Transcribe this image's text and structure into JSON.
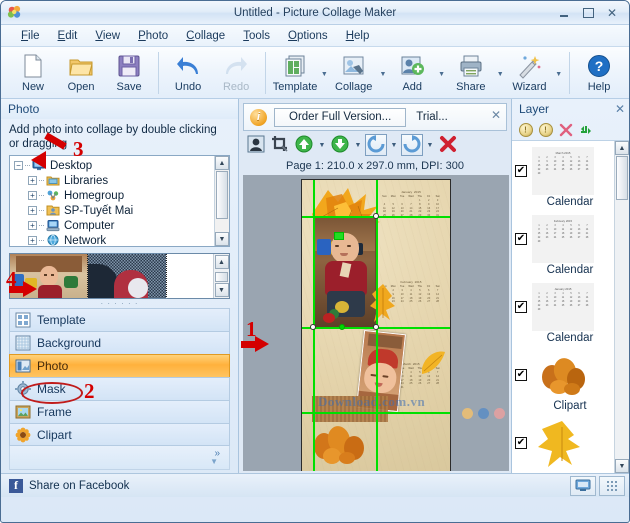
{
  "window": {
    "title": "Untitled - Picture Collage Maker",
    "app_icon": "flower-icon",
    "minimize": "–",
    "maximize": "□",
    "close": "✕"
  },
  "menubar": {
    "items": [
      {
        "label": "File",
        "accel": "F"
      },
      {
        "label": "Edit",
        "accel": "E"
      },
      {
        "label": "View",
        "accel": "V"
      },
      {
        "label": "Photo",
        "accel": "P"
      },
      {
        "label": "Collage",
        "accel": "C"
      },
      {
        "label": "Tools",
        "accel": "T"
      },
      {
        "label": "Options",
        "accel": "O"
      },
      {
        "label": "Help",
        "accel": "H"
      }
    ]
  },
  "toolbar": {
    "items": [
      {
        "label": "New",
        "icon": "new-document-icon",
        "dropdown": false,
        "disabled": false
      },
      {
        "label": "Open",
        "icon": "open-folder-icon",
        "dropdown": false,
        "disabled": false
      },
      {
        "label": "Save",
        "icon": "floppy-disk-icon",
        "dropdown": false,
        "disabled": false
      },
      {
        "label": "Undo",
        "icon": "undo-arrow-icon",
        "dropdown": false,
        "disabled": false
      },
      {
        "label": "Redo",
        "icon": "redo-arrow-icon",
        "dropdown": false,
        "disabled": true
      },
      {
        "label": "Template",
        "icon": "template-icon",
        "dropdown": true,
        "disabled": false
      },
      {
        "label": "Collage",
        "icon": "collage-icon",
        "dropdown": true,
        "disabled": false
      },
      {
        "label": "Add",
        "icon": "add-person-icon",
        "dropdown": true,
        "disabled": false
      },
      {
        "label": "Share",
        "icon": "printer-icon",
        "dropdown": true,
        "disabled": false
      },
      {
        "label": "Wizard",
        "icon": "magic-wand-icon",
        "dropdown": true,
        "disabled": false
      },
      {
        "label": "Help",
        "icon": "help-question-icon",
        "dropdown": false,
        "disabled": false
      }
    ]
  },
  "left_panel": {
    "title": "Photo",
    "hint": "Add photo into collage by double clicking or dragging",
    "tree": [
      {
        "label": "Desktop",
        "level": 0,
        "expander": "−",
        "icon": "monitor-icon"
      },
      {
        "label": "Libraries",
        "level": 1,
        "expander": "+",
        "icon": "library-folder-icon"
      },
      {
        "label": "Homegroup",
        "level": 1,
        "expander": "+",
        "icon": "homegroup-icon"
      },
      {
        "label": "SP-Tuyết Mai",
        "level": 1,
        "expander": "+",
        "icon": "user-folder-icon"
      },
      {
        "label": "Computer",
        "level": 1,
        "expander": "+",
        "icon": "computer-icon"
      },
      {
        "label": "Network",
        "level": 1,
        "expander": "+",
        "icon": "network-icon"
      }
    ],
    "thumbnails": [
      {
        "name": "baby-photo-thumbnail-1",
        "selected": false
      },
      {
        "name": "baby-photo-thumbnail-2",
        "selected": true
      }
    ],
    "categories": [
      {
        "label": "Template",
        "icon": "template-grid-icon",
        "active": false
      },
      {
        "label": "Background",
        "icon": "background-icon",
        "active": false
      },
      {
        "label": "Photo",
        "icon": "photo-icon",
        "active": true
      },
      {
        "label": "Mask",
        "icon": "mask-gear-icon",
        "active": false
      },
      {
        "label": "Frame",
        "icon": "frame-picture-icon",
        "active": false
      },
      {
        "label": "Clipart",
        "icon": "clipart-flower-icon",
        "active": false
      }
    ],
    "expand_more": "»"
  },
  "center_panel": {
    "order_bar": {
      "info_icon": "info-icon",
      "order_button": "Order Full Version...",
      "trial_label": "Trial...",
      "close": "✕"
    },
    "canvas_tools": [
      {
        "name": "portrait-tool",
        "icon": "portrait-icon",
        "dropdown": false,
        "framed": false
      },
      {
        "name": "crop-tool",
        "icon": "crop-icon",
        "dropdown": false,
        "framed": false
      },
      {
        "name": "move-up-tool",
        "icon": "green-up-arrow-icon",
        "dropdown": true,
        "framed": false
      },
      {
        "name": "move-down-tool",
        "icon": "green-down-arrow-icon",
        "dropdown": true,
        "framed": false
      },
      {
        "name": "rotate-left-tool",
        "icon": "rotate-ccw-icon",
        "dropdown": true,
        "framed": true
      },
      {
        "name": "rotate-right-tool",
        "icon": "rotate-cw-icon",
        "dropdown": true,
        "framed": true
      },
      {
        "name": "delete-tool",
        "icon": "red-x-icon",
        "dropdown": false,
        "framed": false
      }
    ],
    "page_label": "Page 1: 210.0 x 297.0 mm, DPI: 300",
    "watermark": "Download.com.vn",
    "calendars": [
      {
        "month": "January",
        "year": "2015",
        "weekdays": [
          "Sun",
          "Mon",
          "Tue",
          "Wed",
          "Thu",
          "Fri",
          "Sat"
        ],
        "rows": [
          [
            "",
            "",
            "",
            "",
            "1",
            "2",
            "3"
          ],
          [
            "4",
            "5",
            "6",
            "7",
            "8",
            "9",
            "10"
          ],
          [
            "11",
            "12",
            "13",
            "14",
            "15",
            "16",
            "17"
          ],
          [
            "18",
            "19",
            "20",
            "21",
            "22",
            "23",
            "24"
          ],
          [
            "25",
            "26",
            "27",
            "28",
            "29",
            "30",
            "31"
          ]
        ]
      },
      {
        "month": "February",
        "year": "2015",
        "weekdays": [
          "Sun",
          "Mon",
          "Tue",
          "Wed",
          "Thu",
          "Fri",
          "Sat"
        ],
        "rows": [
          [
            "1",
            "2",
            "3",
            "4",
            "5",
            "6",
            "7"
          ],
          [
            "8",
            "9",
            "10",
            "11",
            "12",
            "13",
            "14"
          ],
          [
            "15",
            "16",
            "17",
            "18",
            "19",
            "20",
            "21"
          ],
          [
            "22",
            "23",
            "24",
            "25",
            "26",
            "27",
            "28"
          ]
        ]
      },
      {
        "month": "March",
        "year": "2015",
        "weekdays": [
          "Sun",
          "Mon",
          "Tue",
          "Wed",
          "Thu",
          "Fri",
          "Sat"
        ],
        "rows": [
          [
            "1",
            "2",
            "3",
            "4",
            "5",
            "6",
            "7"
          ],
          [
            "8",
            "9",
            "10",
            "11",
            "12",
            "13",
            "14"
          ],
          [
            "15",
            "16",
            "17",
            "18",
            "19",
            "20",
            "21"
          ],
          [
            "22",
            "23",
            "24",
            "25",
            "26",
            "27",
            "28"
          ],
          [
            "29",
            "30",
            "31",
            "",
            "",
            "",
            ""
          ]
        ]
      }
    ]
  },
  "right_panel": {
    "title": "Layer",
    "close": "✕",
    "tools": [
      {
        "name": "layer-up-button",
        "icon": "coin-up-icon"
      },
      {
        "name": "layer-down-button",
        "icon": "coin-down-icon"
      },
      {
        "name": "layer-delete-button",
        "icon": "pink-x-icon"
      },
      {
        "name": "layer-refresh-button",
        "icon": "green-swap-arrows-icon"
      }
    ],
    "layers": [
      {
        "label": "Calendar",
        "thumb": "calendar-march-thumbnail",
        "checked": true
      },
      {
        "label": "Calendar",
        "thumb": "calendar-february-thumbnail",
        "checked": true
      },
      {
        "label": "Calendar",
        "thumb": "calendar-january-thumbnail",
        "checked": true
      },
      {
        "label": "Clipart",
        "thumb": "acorns-clipart-thumbnail",
        "checked": true
      },
      {
        "label": "",
        "thumb": "yellow-leaf-clipart-thumbnail",
        "checked": true
      }
    ]
  },
  "status_bar": {
    "facebook_label": "Share on Facebook",
    "facebook_icon": "facebook-icon",
    "buttons": [
      {
        "name": "display-mode-button",
        "icon": "monitor-small-icon"
      },
      {
        "name": "resize-grip",
        "icon": "grip-dots-icon"
      }
    ]
  },
  "annotations": [
    {
      "id": "1",
      "type": "arrow-right",
      "target": "selected-photo-left-handle"
    },
    {
      "id": "2",
      "type": "ellipse",
      "target": "photo-category-button"
    },
    {
      "id": "3",
      "type": "arrow-down-left",
      "target": "desktop-tree-node"
    },
    {
      "id": "4",
      "type": "arrow-right",
      "target": "photo-thumbnail-strip"
    }
  ]
}
